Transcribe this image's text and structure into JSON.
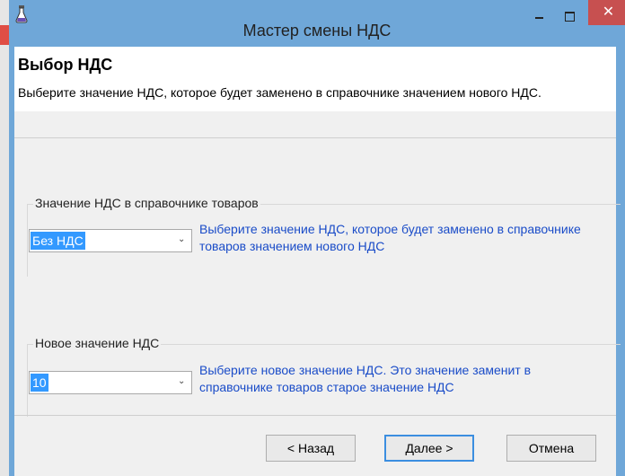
{
  "window": {
    "title": "Мастер смены НДС",
    "close_glyph": "✕"
  },
  "header": {
    "title": "Выбор НДС",
    "description": "Выберите значение НДС, которое будет заменено в справочнике значением нового НДС."
  },
  "group_current": {
    "title": "Значение НДС в справочнике товаров",
    "selected_value": "Без НДС",
    "hint": "Выберите значение НДС, которое будет заменено в справочнике товаров значением нового НДС"
  },
  "group_new": {
    "title": "Новое значение НДС",
    "selected_value": "10",
    "hint": "Выберите новое значение НДС. Это значение заменит в справочнике товаров старое значение НДС"
  },
  "buttons": {
    "back": "< Назад",
    "next": "Далее >",
    "cancel": "Отмена"
  },
  "colors": {
    "titlebar": "#6fa7d8",
    "close_button": "#c75050",
    "hint_text": "#1a4cc8",
    "selection": "#3399ff"
  }
}
